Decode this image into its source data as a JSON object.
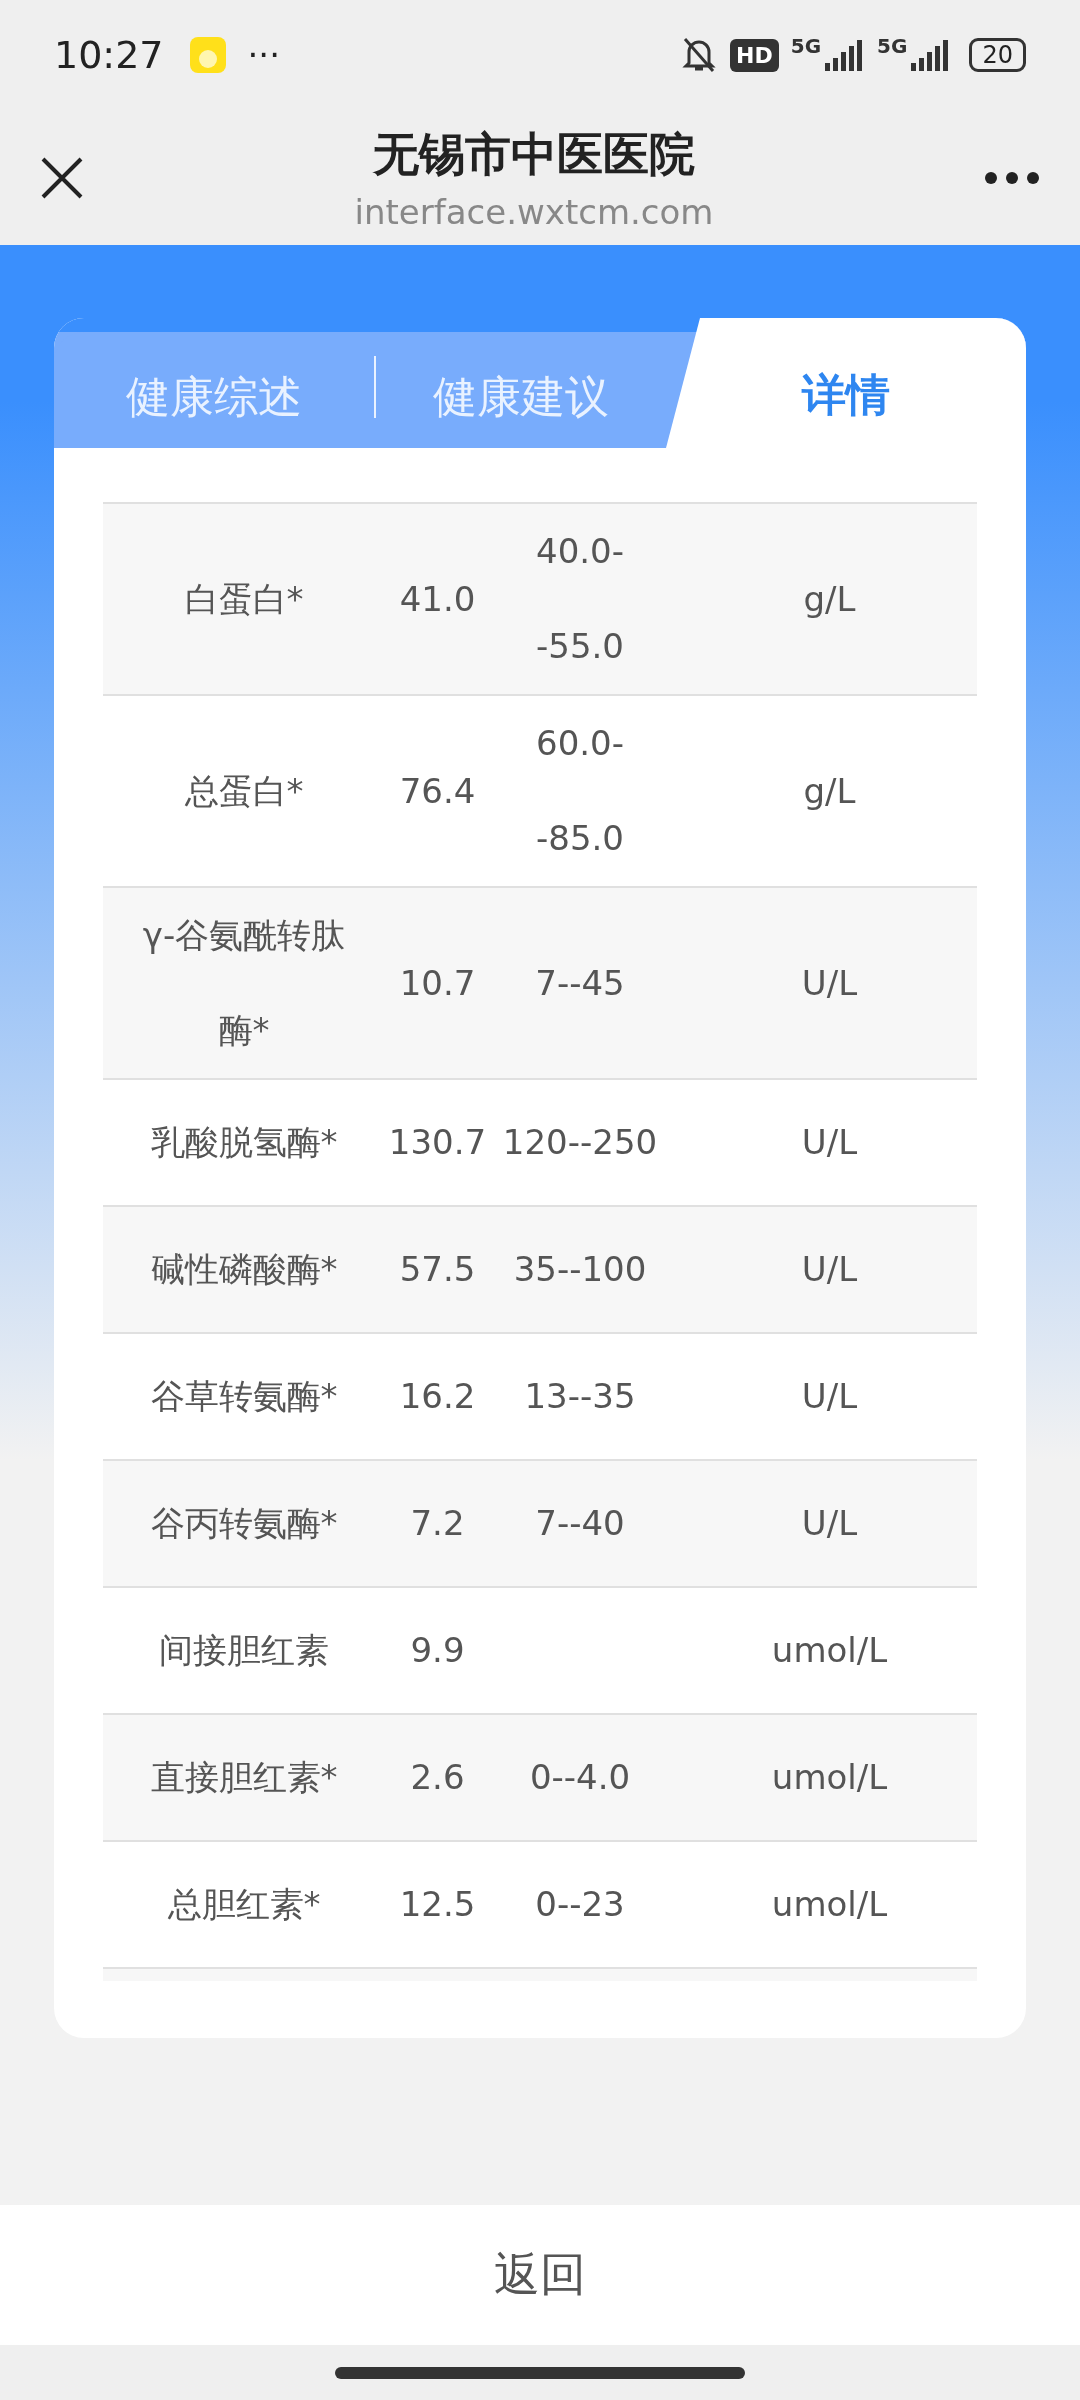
{
  "status_bar": {
    "time": "10:27",
    "overflow": "···",
    "hd": "HD",
    "network_1": "5G",
    "network_2": "5G",
    "battery": "20"
  },
  "header": {
    "title": "无锡市中医医院",
    "url": "interface.wxtcm.com"
  },
  "tabs": [
    {
      "label": "健康综述",
      "selected": false
    },
    {
      "label": "健康建议",
      "selected": false
    },
    {
      "label": "详情",
      "selected": true
    }
  ],
  "rows": [
    {
      "name": "白蛋白*",
      "value": "41.0",
      "range": [
        "40.0-",
        "-55.0"
      ],
      "unit": "g/L"
    },
    {
      "name": "总蛋白*",
      "value": "76.4",
      "range": [
        "60.0-",
        "-85.0"
      ],
      "unit": "g/L"
    },
    {
      "name": "γ-谷氨酰转肽酶*",
      "value": "10.7",
      "range": [
        "7--45"
      ],
      "unit": "U/L"
    },
    {
      "name": "乳酸脱氢酶*",
      "value": "130.7",
      "range": [
        "120--250"
      ],
      "unit": "U/L"
    },
    {
      "name": "碱性磷酸酶*",
      "value": "57.5",
      "range": [
        "35--100"
      ],
      "unit": "U/L"
    },
    {
      "name": "谷草转氨酶*",
      "value": "16.2",
      "range": [
        "13--35"
      ],
      "unit": "U/L"
    },
    {
      "name": "谷丙转氨酶*",
      "value": "7.2",
      "range": [
        "7--40"
      ],
      "unit": "U/L"
    },
    {
      "name": "间接胆红素",
      "value": "9.9",
      "range": [],
      "unit": "umol/L"
    },
    {
      "name": "直接胆红素*",
      "value": "2.6",
      "range": [
        "0--4.0"
      ],
      "unit": "umol/L"
    },
    {
      "name": "总胆红素*",
      "value": "12.5",
      "range": [
        "0--23"
      ],
      "unit": "umol/L"
    }
  ],
  "back_button": "返回"
}
